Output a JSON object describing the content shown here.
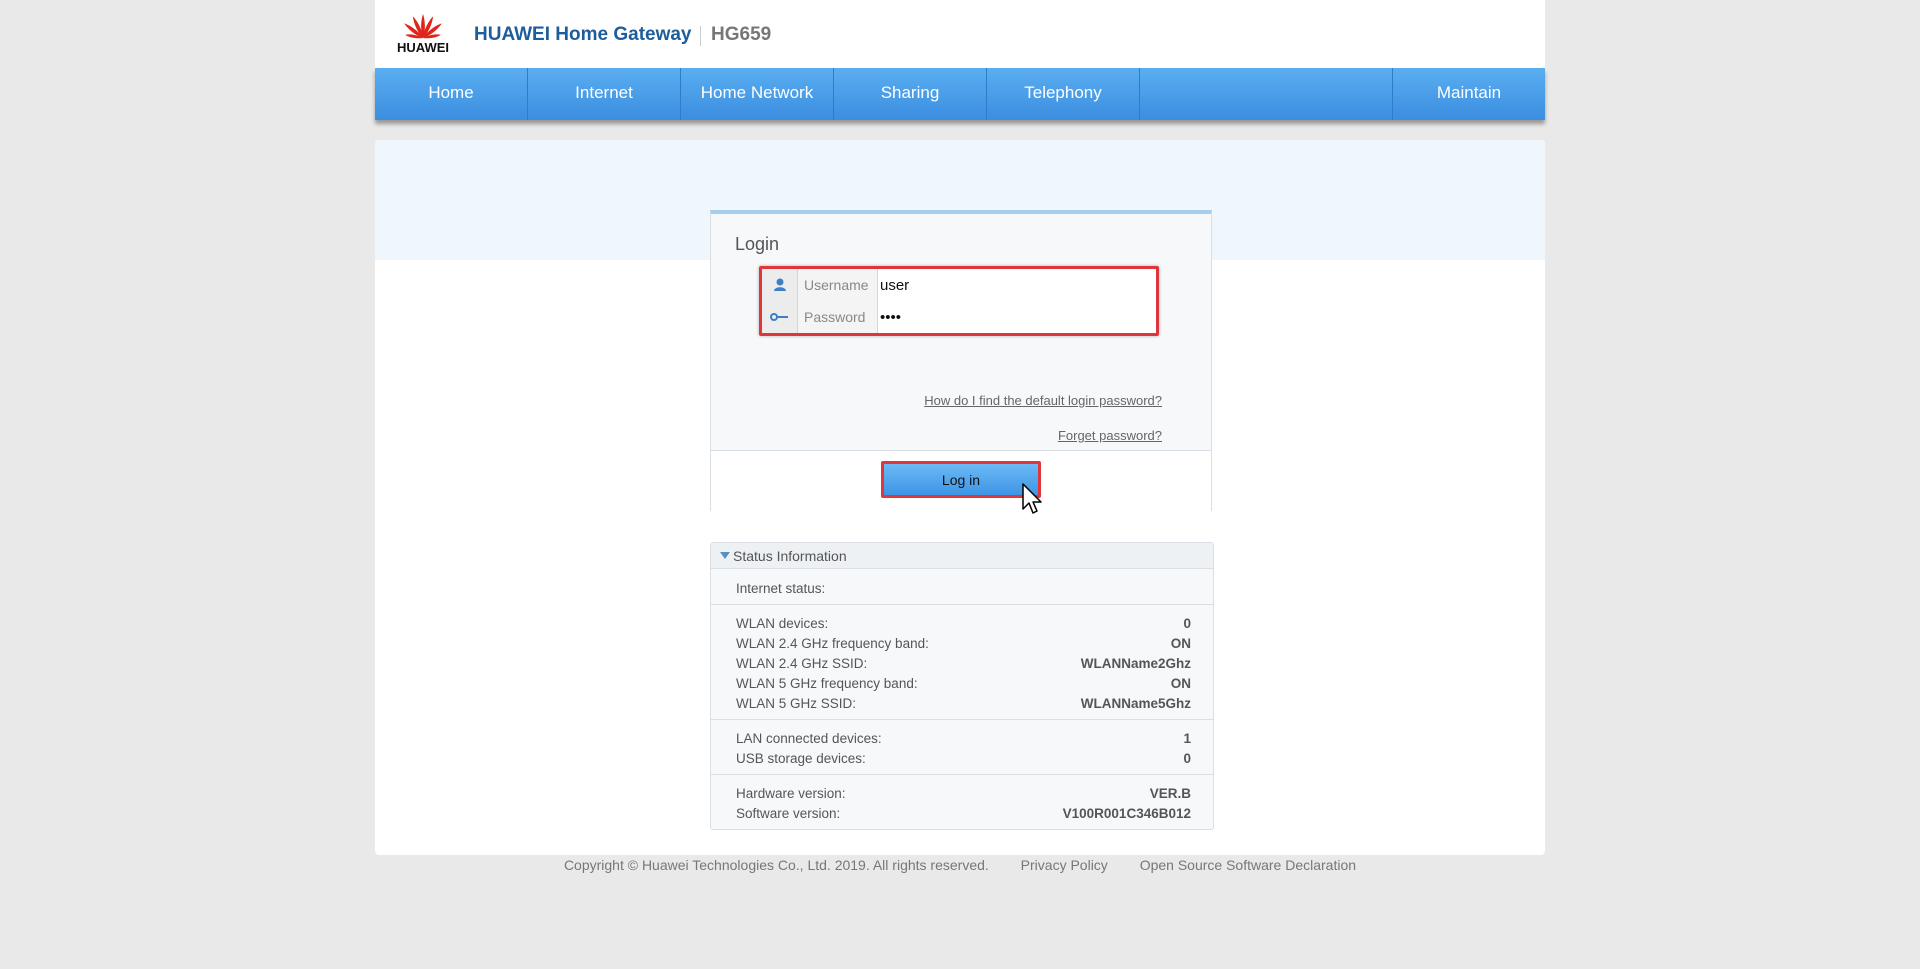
{
  "header": {
    "logo_text": "HUAWEI",
    "product_name": "HUAWEI Home Gateway",
    "model": "HG659"
  },
  "nav": {
    "items": [
      "Home",
      "Internet",
      "Home Network",
      "Sharing",
      "Telephony"
    ],
    "maintain": "Maintain"
  },
  "login": {
    "title": "Login",
    "username_label": "Username",
    "username_value": "user",
    "password_label": "Password",
    "password_value": "••••",
    "help_link": "How do I find the default login password?",
    "forget_link": "Forget password?",
    "button_label": "Log in"
  },
  "status": {
    "title": "Status Information",
    "internet_label": "Internet status:",
    "wlan": [
      {
        "k": "WLAN devices:",
        "v": "0"
      },
      {
        "k": "WLAN 2.4 GHz frequency band:",
        "v": "ON"
      },
      {
        "k": "WLAN 2.4 GHz SSID:",
        "v": "WLANName2Ghz"
      },
      {
        "k": "WLAN 5 GHz frequency band:",
        "v": "ON"
      },
      {
        "k": "WLAN 5 GHz SSID:",
        "v": "WLANName5Ghz"
      }
    ],
    "lan": [
      {
        "k": "LAN connected devices:",
        "v": "1"
      },
      {
        "k": "USB storage devices:",
        "v": "0"
      }
    ],
    "version": [
      {
        "k": "Hardware version:",
        "v": "VER.B"
      },
      {
        "k": "Software version:",
        "v": "V100R001C346B012"
      }
    ]
  },
  "footer": {
    "copyright": "Copyright © Huawei Technologies Co., Ltd. 2019. All rights reserved.",
    "privacy": "Privacy Policy",
    "open_source": "Open Source Software Declaration"
  },
  "icons": {
    "user": "user-icon",
    "password": "key-icon",
    "cursor": "mouse-pointer-icon"
  },
  "colors": {
    "nav": "#3b8ee0",
    "brand_text": "#1d5d9c",
    "highlight": "#e0353b"
  }
}
